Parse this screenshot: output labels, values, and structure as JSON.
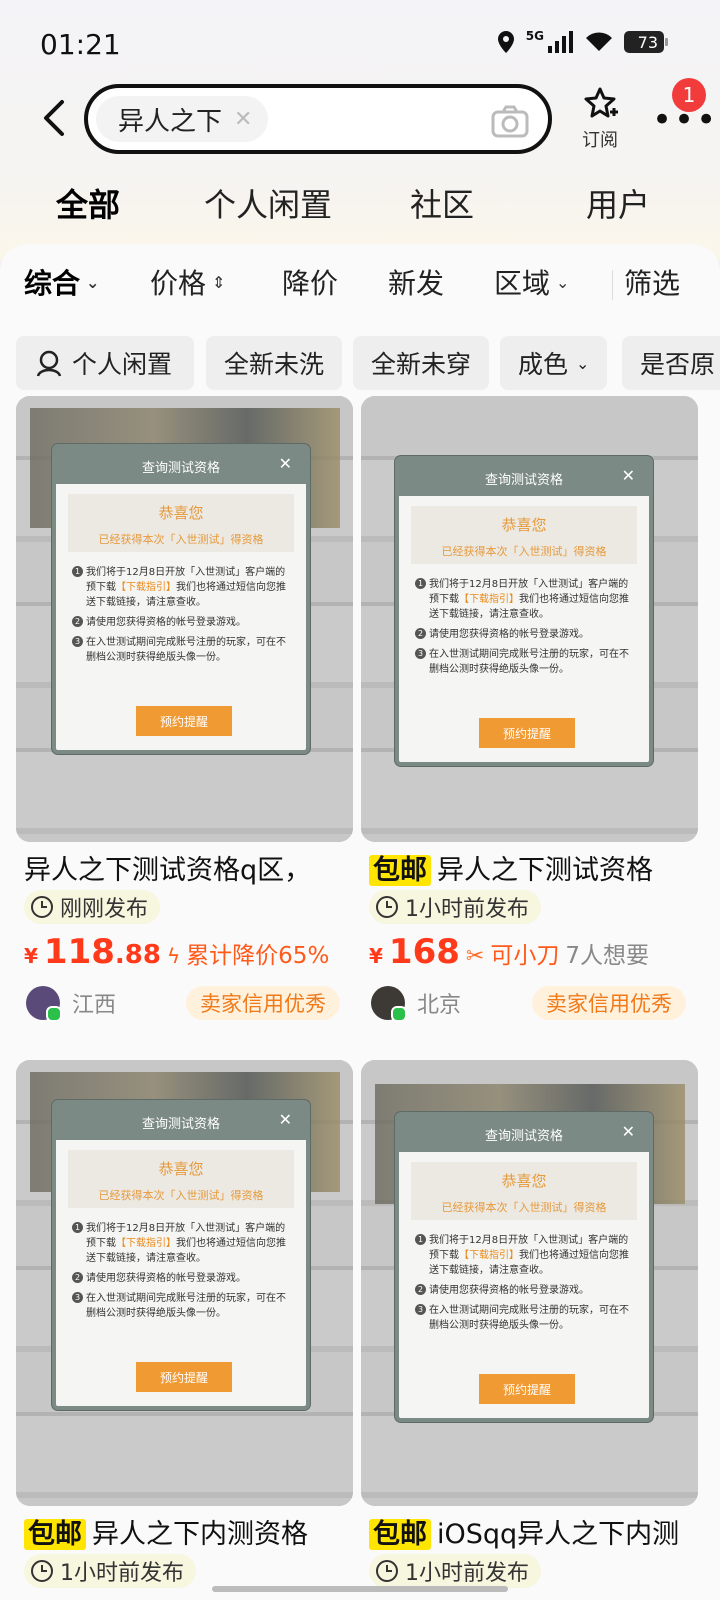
{
  "status": {
    "time": "01:21",
    "network": "5G",
    "battery": "73"
  },
  "search": {
    "query": "异人之下"
  },
  "header": {
    "subscribe_label": "订阅",
    "notification_count": "1"
  },
  "tabs": [
    {
      "label": "全部",
      "active": true
    },
    {
      "label": "个人闲置"
    },
    {
      "label": "社区"
    },
    {
      "label": "用户"
    }
  ],
  "sort": [
    {
      "label": "综合",
      "active": true
    },
    {
      "label": "价格"
    },
    {
      "label": "降价"
    },
    {
      "label": "新发"
    },
    {
      "label": "区域"
    },
    {
      "label": "筛选"
    }
  ],
  "filters": [
    "个人闲置",
    "全新未洗",
    "全新未穿",
    "成色",
    "是否原"
  ],
  "dialog": {
    "header": "查询测试资格",
    "congrats": "恭喜您",
    "sub": "已经获得本次「入世测试」得资格",
    "item1_a": "我们将于12月8日开放「入世测试」客户端的预下载",
    "item1_hl": "【下载指引】",
    "item1_b": "我们也将通过短信向您推送下载链接，请注意查收。",
    "item2": "请使用您获得资格的帐号登录游戏。",
    "item3": "在入世测试期间完成账号注册的玩家，可在不删档公测时获得绝版头像一份。",
    "button": "预约提醒"
  },
  "listings": [
    {
      "title": "异人之下测试资格q区，",
      "free_shipping": "",
      "posted": "刚刚发布",
      "price_main": "118",
      "price_dec": ".88",
      "price_tag": "累计降价65%",
      "wants": "",
      "location": "江西",
      "credit": "卖家信用优秀"
    },
    {
      "title": "异人之下测试资格",
      "free_shipping": "包邮",
      "posted": "1小时前发布",
      "price_main": "168",
      "price_dec": "",
      "price_tag": "可小刀",
      "wants": "7人想要",
      "location": "北京",
      "credit": "卖家信用优秀"
    },
    {
      "title": "异人之下内测资格",
      "free_shipping": "包邮",
      "posted": "1小时前发布"
    },
    {
      "title": "iOSqq异人之下内测",
      "free_shipping": "包邮",
      "posted": "1小时前发布"
    }
  ],
  "colors": {
    "accent_yellow": "#ffe500",
    "price_red": "#ff3a1a",
    "credit_orange": "#f07a1a"
  }
}
